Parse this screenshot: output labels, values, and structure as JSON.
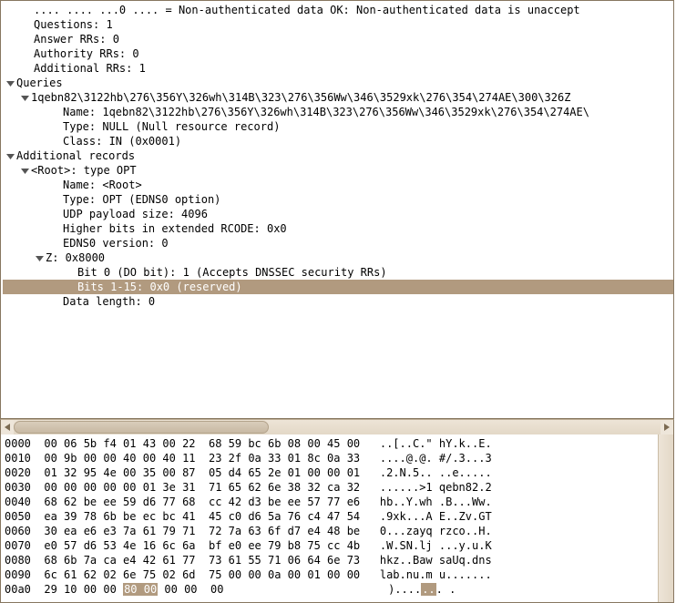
{
  "details": {
    "items": [
      {
        "indent": 32,
        "tri": "",
        "text": ".... .... ...0 .... = Non-authenticated data OK: Non-authenticated data is unaccept"
      },
      {
        "indent": 32,
        "tri": "",
        "text": "Questions: 1"
      },
      {
        "indent": 32,
        "tri": "",
        "text": "Answer RRs: 0"
      },
      {
        "indent": 32,
        "tri": "",
        "text": "Authority RRs: 0"
      },
      {
        "indent": 32,
        "tri": "",
        "text": "Additional RRs: 1"
      },
      {
        "indent": 16,
        "tri": "down",
        "text": "Queries"
      },
      {
        "indent": 32,
        "tri": "down",
        "text": "1qebn82\\3122hb\\276\\356Y\\326wh\\314B\\323\\276\\356Ww\\346\\3529xk\\276\\354\\274AE\\300\\326Z"
      },
      {
        "indent": 64,
        "tri": "",
        "text": "Name: 1qebn82\\3122hb\\276\\356Y\\326wh\\314B\\323\\276\\356Ww\\346\\3529xk\\276\\354\\274AE\\"
      },
      {
        "indent": 64,
        "tri": "",
        "text": "Type: NULL (Null resource record)"
      },
      {
        "indent": 64,
        "tri": "",
        "text": "Class: IN (0x0001)"
      },
      {
        "indent": 16,
        "tri": "down",
        "text": "Additional records"
      },
      {
        "indent": 32,
        "tri": "down",
        "text": "<Root>: type OPT"
      },
      {
        "indent": 64,
        "tri": "",
        "text": "Name: <Root>"
      },
      {
        "indent": 64,
        "tri": "",
        "text": "Type: OPT (EDNS0 option)"
      },
      {
        "indent": 64,
        "tri": "",
        "text": "UDP payload size: 4096"
      },
      {
        "indent": 64,
        "tri": "",
        "text": "Higher bits in extended RCODE: 0x0"
      },
      {
        "indent": 64,
        "tri": "",
        "text": "EDNS0 version: 0"
      },
      {
        "indent": 48,
        "tri": "down",
        "text": "Z: 0x8000"
      },
      {
        "indent": 80,
        "tri": "",
        "text": "Bit 0 (DO bit): 1 (Accepts DNSSEC security RRs)"
      },
      {
        "indent": 80,
        "tri": "",
        "text": "Bits 1-15: 0x0 (reserved)",
        "selected": true
      },
      {
        "indent": 64,
        "tri": "",
        "text": "Data length: 0"
      }
    ]
  },
  "hex": {
    "rows": [
      {
        "off": "0000",
        "h1": "00 06 5b f4 01 43 00 22",
        "h2": "68 59 bc 6b 08 00 45 00",
        "a": "..[..C.\" hY.k..E."
      },
      {
        "off": "0010",
        "h1": "00 9b 00 00 40 00 40 11",
        "h2": "23 2f 0a 33 01 8c 0a 33",
        "a": "....@.@. #/.3...3"
      },
      {
        "off": "0020",
        "h1": "01 32 95 4e 00 35 00 87",
        "h2": "05 d4 65 2e 01 00 00 01",
        "a": ".2.N.5.. ..e....."
      },
      {
        "off": "0030",
        "h1": "00 00 00 00 00 01 3e 31",
        "h2": "71 65 62 6e 38 32 ca 32",
        "a": "......>1 qebn82.2"
      },
      {
        "off": "0040",
        "h1": "68 62 be ee 59 d6 77 68",
        "h2": "cc 42 d3 be ee 57 77 e6",
        "a": "hb..Y.wh .B...Ww."
      },
      {
        "off": "0050",
        "h1": "ea 39 78 6b be ec bc 41",
        "h2": "45 c0 d6 5a 76 c4 47 54",
        "a": ".9xk...A E..Zv.GT"
      },
      {
        "off": "0060",
        "h1": "30 ea e6 e3 7a 61 79 71",
        "h2": "72 7a 63 6f d7 e4 48 be",
        "a": "0...zayq rzco..H."
      },
      {
        "off": "0070",
        "h1": "e0 57 d6 53 4e 16 6c 6a",
        "h2": "bf e0 ee 79 b8 75 cc 4b",
        "a": ".W.SN.lj ...y.u.K"
      },
      {
        "off": "0080",
        "h1": "68 6b 7a ca e4 42 61 77",
        "h2": "73 61 55 71 06 64 6e 73",
        "a": "hkz..Baw saUq.dns"
      },
      {
        "off": "0090",
        "h1": "6c 61 62 02 6e 75 02 6d",
        "h2": "75 00 00 0a 00 01 00 00",
        "a": "lab.nu.m u......."
      },
      {
        "off": "00a0",
        "h1": "29 10 00 00 ",
        "hl": "80 00",
        "h1b": " 00 00",
        "h2": "00",
        "a": ")....",
        "ahl": "..",
        "a2": ". ."
      }
    ]
  }
}
